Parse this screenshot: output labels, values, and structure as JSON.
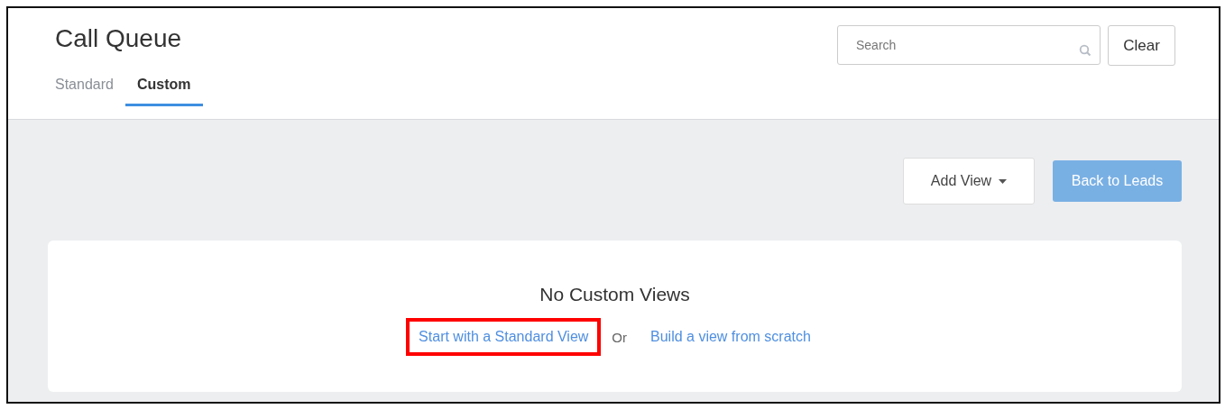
{
  "header": {
    "title": "Call Queue"
  },
  "tabs": [
    {
      "label": "Standard",
      "selected": false
    },
    {
      "label": "Custom",
      "selected": true
    }
  ],
  "search": {
    "placeholder": "Search"
  },
  "clear_button": "Clear",
  "toolbar": {
    "add_view": "Add View",
    "back": "Back to Leads"
  },
  "empty_state": {
    "title": "No Custom Views",
    "links": [
      {
        "label": "Start with a Standard View",
        "highlighted": true
      },
      {
        "label": "Build a view from scratch",
        "highlighted": false
      }
    ],
    "separator": "Or"
  }
}
